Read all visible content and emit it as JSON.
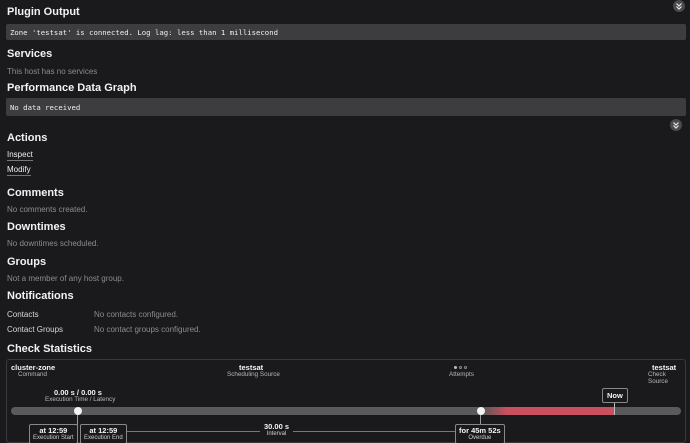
{
  "plugin_output": {
    "title": "Plugin Output",
    "text": "Zone 'testsat' is connected. Log lag: less than 1 millisecond"
  },
  "services": {
    "title": "Services",
    "text": "This host has no services"
  },
  "perfdata": {
    "title": "Performance Data Graph",
    "text": "No data received"
  },
  "actions": {
    "title": "Actions",
    "items": [
      "Inspect",
      "Modify"
    ]
  },
  "comments": {
    "title": "Comments",
    "text": "No comments created."
  },
  "downtimes": {
    "title": "Downtimes",
    "text": "No downtimes scheduled."
  },
  "groups": {
    "title": "Groups",
    "text": "Not a member of any host group."
  },
  "notifications": {
    "title": "Notifications",
    "rows": [
      {
        "label": "Contacts",
        "value": "No contacts configured."
      },
      {
        "label": "Contact Groups",
        "value": "No contact groups configured."
      }
    ]
  },
  "check_statistics": {
    "title": "Check Statistics",
    "command": {
      "value": "cluster-zone",
      "label": "Command"
    },
    "scheduling_source": {
      "value": "testsat",
      "label": "Scheduling Source"
    },
    "attempts": {
      "label": "Attempts"
    },
    "check_source": {
      "value": "testsat",
      "label": "Check Source"
    },
    "execution": {
      "value": "0.00 s / 0.00 s",
      "label": "Execution Time / Latency"
    },
    "now": "Now",
    "execution_start": {
      "value": "at 12:59",
      "label": "Execution Start"
    },
    "execution_end": {
      "value": "at 12:59",
      "label": "Execution End"
    },
    "interval": {
      "value": "30.00 s",
      "label": "Interval"
    },
    "overdue": {
      "value": "for 45m 52s",
      "label": "Overdue"
    }
  },
  "colors": {
    "background": "#1a1a1d",
    "code_block": "#3d3d40",
    "overdue_bar": "#c9505e",
    "timeline_bar": "#5a5a5c"
  }
}
